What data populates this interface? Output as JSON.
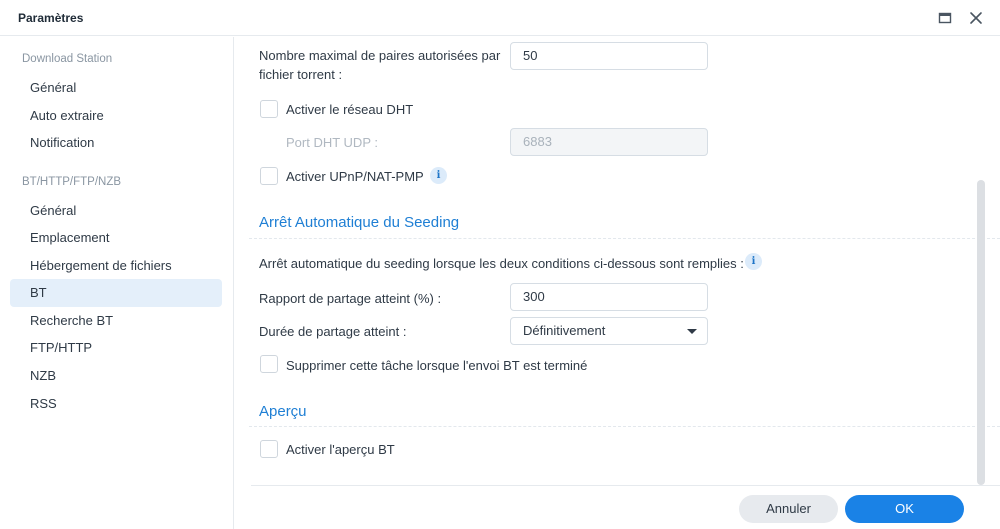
{
  "window": {
    "title": "Paramètres"
  },
  "sidebar": {
    "sections": [
      {
        "label": "Download Station",
        "items": [
          {
            "label": "Général"
          },
          {
            "label": "Auto extraire"
          },
          {
            "label": "Notification"
          }
        ]
      },
      {
        "label": "BT/HTTP/FTP/NZB",
        "items": [
          {
            "label": "Général"
          },
          {
            "label": "Emplacement"
          },
          {
            "label": "Hébergement de fichiers"
          },
          {
            "label": "BT",
            "active": true
          },
          {
            "label": "Recherche BT"
          },
          {
            "label": "FTP/HTTP"
          },
          {
            "label": "NZB"
          },
          {
            "label": "RSS"
          }
        ]
      }
    ]
  },
  "main": {
    "max_peers": {
      "label_line1": "Nombre maximal de paires autorisées par",
      "label_line2": "fichier torrent :",
      "value": "50"
    },
    "dht": {
      "label": "Activer le réseau DHT",
      "checked": false
    },
    "dht_port": {
      "label": "Port DHT UDP :",
      "value": "6883"
    },
    "upnp": {
      "label": "Activer UPnP/NAT-PMP",
      "checked": false
    },
    "seeding": {
      "title": "Arrêt Automatique du Seeding",
      "description": "Arrêt automatique du seeding lorsque les deux conditions ci-dessous sont remplies :",
      "ratio_label": "Rapport de partage atteint (%) :",
      "ratio_value": "300",
      "duration_label": "Durée de partage atteint :",
      "duration_value": "Définitivement",
      "delete_label": "Supprimer cette tâche lorsque l'envoi BT est terminé",
      "delete_checked": false
    },
    "preview": {
      "title": "Aperçu",
      "enable_label": "Activer l'aperçu BT",
      "checked": false
    },
    "info_glyph": "i"
  },
  "footer": {
    "cancel_label": "Annuler",
    "ok_label": "OK"
  },
  "colors": {
    "accent": "#1a82e6",
    "section_title": "#1f7fd4",
    "active_item_bg": "#e4effa"
  }
}
